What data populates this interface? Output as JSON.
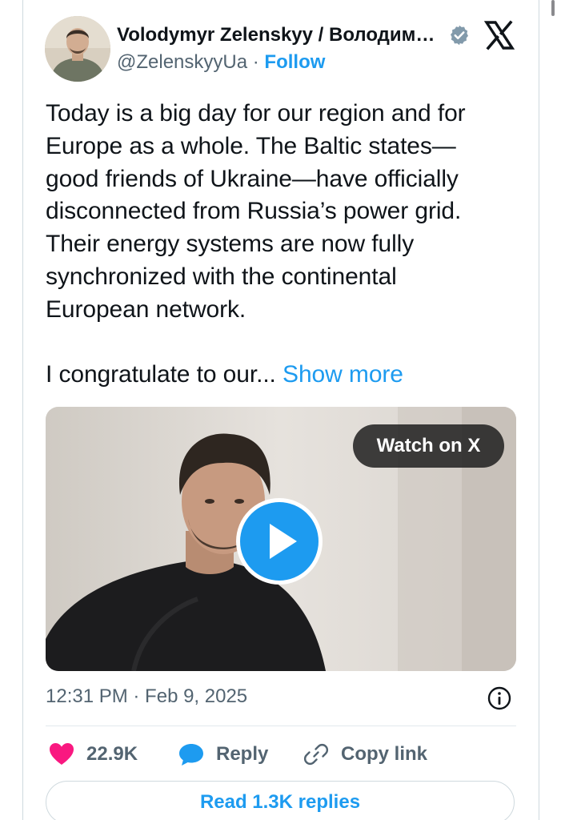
{
  "author": {
    "display_name": "Volodymyr Zelenskyy / Володимир Зеленський",
    "handle": "@ZelenskyyUa",
    "separator": "·",
    "follow_label": "Follow",
    "verified": true
  },
  "tweet": {
    "text_lines": [
      "Today is a big day for our region and for",
      "Europe as a whole. The Baltic states—",
      "good friends of Ukraine—have officially",
      "disconnected from Russia’s power grid.",
      "Their energy systems are now fully",
      "synchronized with the continental",
      "European network."
    ],
    "truncated_line": "I congratulate to our...",
    "show_more_label": "Show more",
    "timestamp": "12:31 PM · Feb 9, 2025"
  },
  "media": {
    "type": "video",
    "watch_label": "Watch on X"
  },
  "actions": {
    "like_count": "22.9K",
    "reply_label": "Reply",
    "copy_link_label": "Copy link",
    "read_replies_label": "Read 1.3K replies"
  },
  "icons": {
    "brand": "x-logo-icon",
    "verified": "verified-badge-icon",
    "like": "heart-icon",
    "reply": "speech-bubble-icon",
    "copy": "link-icon",
    "info": "info-icon",
    "play": "play-icon"
  },
  "colors": {
    "accent": "#1d9bf0",
    "like": "#f91880",
    "text": "#0f1419",
    "secondary_text": "#536471",
    "border": "#cfd9de"
  }
}
